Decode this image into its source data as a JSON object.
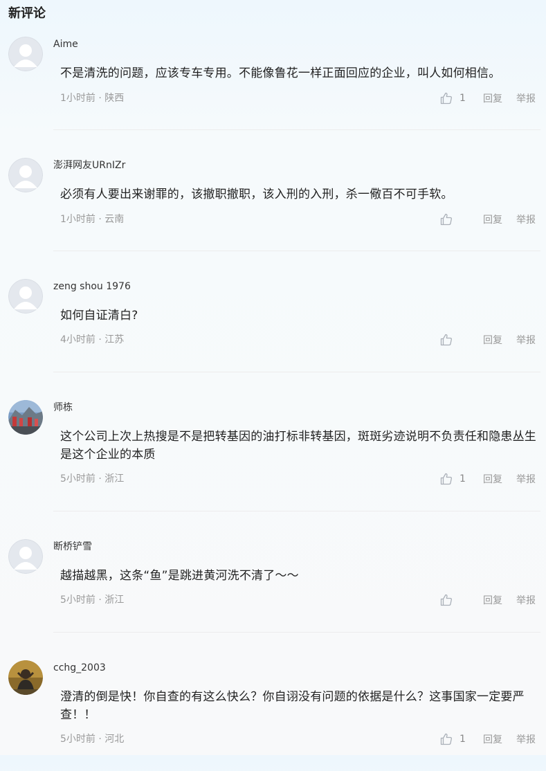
{
  "section_title": "新评论",
  "reply_label": "回复",
  "report_label": "举报",
  "comments": [
    {
      "username": "Aime",
      "content": "不是清洗的问题，应该专车专用。不能像鲁花一样正面回应的企业，叫人如何相信。",
      "time": "1小时前",
      "location": "陕西",
      "meta": "1小时前 · 陕西",
      "likes": "1",
      "avatar": "default"
    },
    {
      "username": "澎湃网友URnIZr",
      "content": "必须有人要出来谢罪的，该撤职撤职，该入刑的入刑，杀一儆百不可手软。",
      "time": "1小时前",
      "location": "云南",
      "meta": "1小时前 · 云南",
      "likes": "",
      "avatar": "default"
    },
    {
      "username": "zeng shou 1976",
      "content": "如何自证清白?",
      "time": "4小时前",
      "location": "江苏",
      "meta": "4小时前 · 江苏",
      "likes": "",
      "avatar": "default"
    },
    {
      "username": "师栋",
      "content": "这个公司上次上热搜是不是把转基因的油打标非转基因，斑斑劣迹说明不负责任和隐患丛生是这个企业的本质",
      "time": "5小时前",
      "location": "浙江",
      "meta": "5小时前 · 浙江",
      "likes": "1",
      "avatar": "photo-crowd"
    },
    {
      "username": "断桥铲雪",
      "content": "越描越黑，这条“鱼”是跳进黄河洗不清了～～",
      "time": "5小时前",
      "location": "浙江",
      "meta": "5小时前 · 浙江",
      "likes": "",
      "avatar": "default"
    },
    {
      "username": "cchg_2003",
      "content": "澄清的倒是快！你自查的有这么快么？你自诩没有问题的依据是什么？这事国家一定要严查！！",
      "time": "5小时前",
      "location": "河北",
      "meta": "5小时前 · 河北",
      "likes": "1",
      "avatar": "photo-person"
    }
  ],
  "colors": {
    "text_primary": "#222222",
    "text_meta": "#999999",
    "avatar_default_bg": "#e4e8ee",
    "divider": "#ececec"
  },
  "icons": {
    "like": "thumbs-up-icon",
    "default_avatar": "user-silhouette-icon"
  }
}
